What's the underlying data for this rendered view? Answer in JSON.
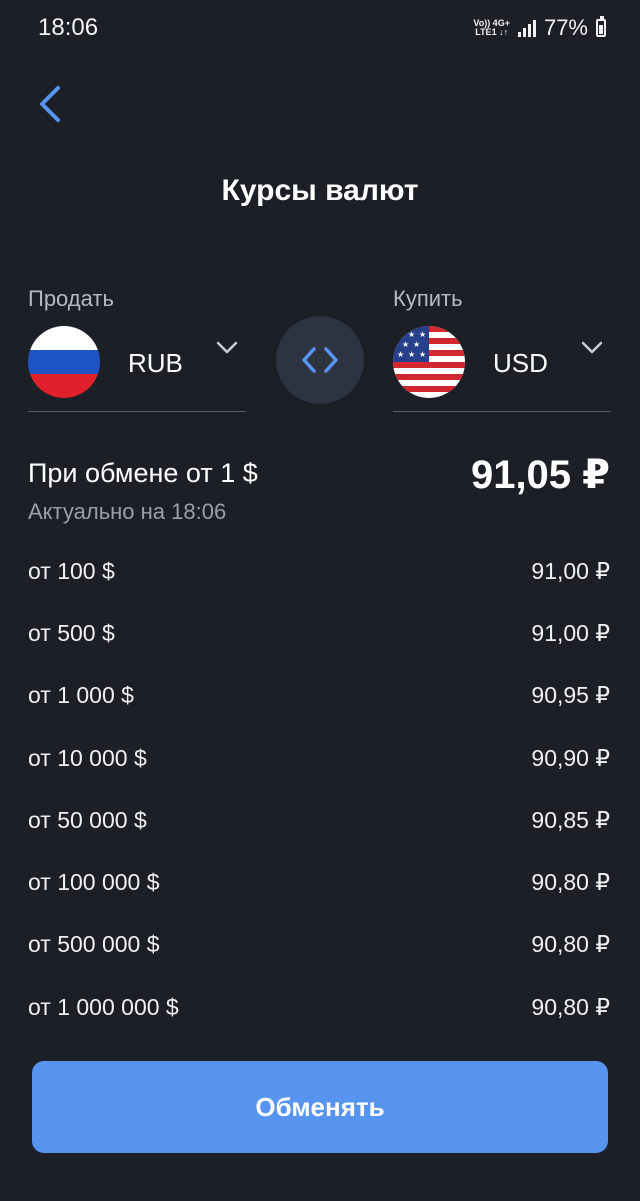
{
  "status_bar": {
    "time": "18:06",
    "network_top": "Vo)) 4G+",
    "network_bottom": "LTE1 ↓↑",
    "battery": "77%"
  },
  "header": {
    "title": "Курсы валют",
    "back_icon": "chevron-left-icon"
  },
  "sell": {
    "label": "Продать",
    "currency": "RUB",
    "flag_icon": "russia-flag-icon"
  },
  "buy": {
    "label": "Купить",
    "currency": "USD",
    "flag_icon": "usa-flag-icon"
  },
  "swap_icon": "swap-arrows-icon",
  "rate": {
    "main_label": "При обмене от 1 $",
    "main_value": "91,05 ₽",
    "updated": "Актуально на 18:06",
    "tiers": [
      {
        "from": "от 100 $",
        "rate": "91,00 ₽"
      },
      {
        "from": "от 500 $",
        "rate": "91,00 ₽"
      },
      {
        "from": "от 1 000 $",
        "rate": "90,95 ₽"
      },
      {
        "from": "от 10 000 $",
        "rate": "90,90 ₽"
      },
      {
        "from": "от 50 000 $",
        "rate": "90,85 ₽"
      },
      {
        "from": "от 100 000 $",
        "rate": "90,80 ₽"
      },
      {
        "from": "от 500 000 $",
        "rate": "90,80 ₽"
      },
      {
        "from": "от 1 000 000 $",
        "rate": "90,80 ₽"
      }
    ]
  },
  "action": {
    "exchange_label": "Обменять"
  },
  "colors": {
    "background": "#1c1f26",
    "accent": "#5694ef",
    "swap_bg": "#2d3340",
    "muted_text": "#9a9ea8"
  }
}
